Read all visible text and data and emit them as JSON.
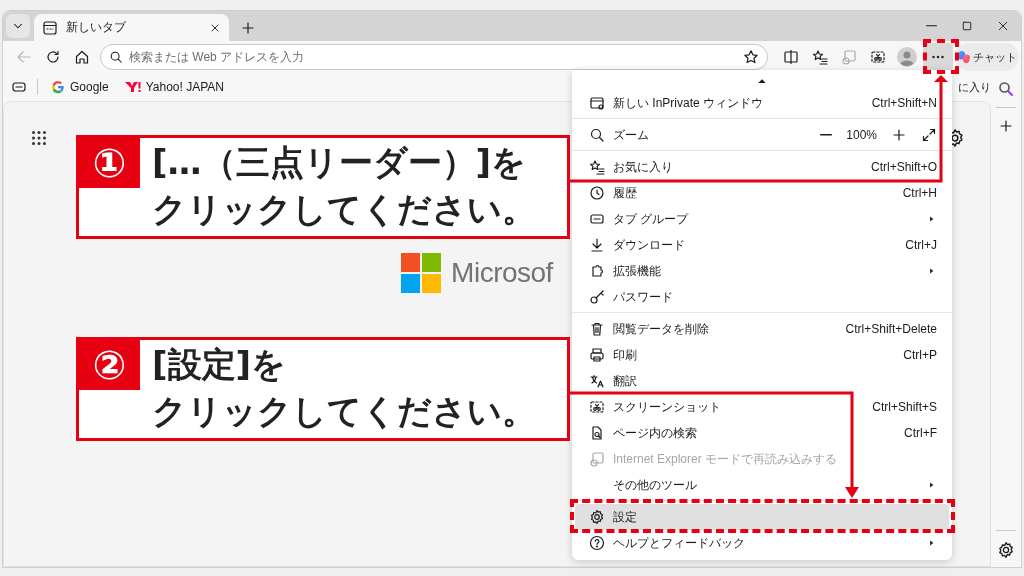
{
  "tabs": [
    {
      "title": "新しいタブ",
      "selected": true
    }
  ],
  "address_bar": {
    "placeholder": "検索または Web アドレスを入力"
  },
  "chat_button": {
    "label": "チャット"
  },
  "bookmarks": [
    {
      "label": "Google"
    },
    {
      "label": "Yahoo! JAPAN"
    }
  ],
  "bookmarks_right": "に入り",
  "new_tab_page": {
    "logo_text": "Microsof"
  },
  "menu": {
    "groups": [
      [
        {
          "kind": "item",
          "label": "新しい InPrivate ウィンドウ",
          "shortcut": "Ctrl+Shift+N",
          "submenu": false,
          "disabled": false,
          "selected": false
        }
      ],
      [
        {
          "kind": "zoom",
          "label": "ズーム",
          "value": "100%"
        }
      ],
      [
        {
          "kind": "item",
          "label": "お気に入り",
          "shortcut": "Ctrl+Shift+O",
          "submenu": false,
          "disabled": false,
          "selected": false
        },
        {
          "kind": "item",
          "label": "履歴",
          "shortcut": "Ctrl+H",
          "submenu": false,
          "disabled": false,
          "selected": false
        },
        {
          "kind": "item",
          "label": "タブ グループ",
          "submenu": true,
          "disabled": false,
          "selected": false
        },
        {
          "kind": "item",
          "label": "ダウンロード",
          "shortcut": "Ctrl+J",
          "submenu": false,
          "disabled": false,
          "selected": false
        },
        {
          "kind": "item",
          "label": "拡張機能",
          "submenu": true,
          "disabled": false,
          "selected": false
        },
        {
          "kind": "item",
          "label": "パスワード",
          "submenu": false,
          "disabled": false,
          "selected": false
        }
      ],
      [
        {
          "kind": "item",
          "label": "閲覧データを削除",
          "shortcut": "Ctrl+Shift+Delete",
          "submenu": false,
          "disabled": false,
          "selected": false
        },
        {
          "kind": "item",
          "label": "印刷",
          "shortcut": "Ctrl+P",
          "submenu": false,
          "disabled": false,
          "selected": false
        },
        {
          "kind": "item",
          "label": "翻訳",
          "submenu": false,
          "disabled": false,
          "selected": false
        },
        {
          "kind": "item",
          "label": "スクリーンショット",
          "shortcut": "Ctrl+Shift+S",
          "submenu": false,
          "disabled": false,
          "selected": false
        },
        {
          "kind": "item",
          "label": "ページ内の検索",
          "shortcut": "Ctrl+F",
          "submenu": false,
          "disabled": false,
          "selected": false
        },
        {
          "kind": "item",
          "label": "Internet Explorer モードで再読み込みする",
          "submenu": false,
          "disabled": true,
          "selected": false
        },
        {
          "kind": "item",
          "label": "その他のツール",
          "submenu": true,
          "disabled": false,
          "selected": false
        }
      ],
      [
        {
          "kind": "item",
          "label": "設定",
          "submenu": false,
          "disabled": false,
          "selected": true
        },
        {
          "kind": "item",
          "label": "ヘルプとフィードバック",
          "submenu": true,
          "disabled": false,
          "selected": false
        }
      ]
    ]
  },
  "annotations": [
    {
      "number": "①",
      "lines": [
        "[…（三点リーダー）]を",
        "クリックしてください。"
      ]
    },
    {
      "number": "②",
      "lines": [
        "[設定]を",
        "クリックしてください。"
      ]
    }
  ]
}
